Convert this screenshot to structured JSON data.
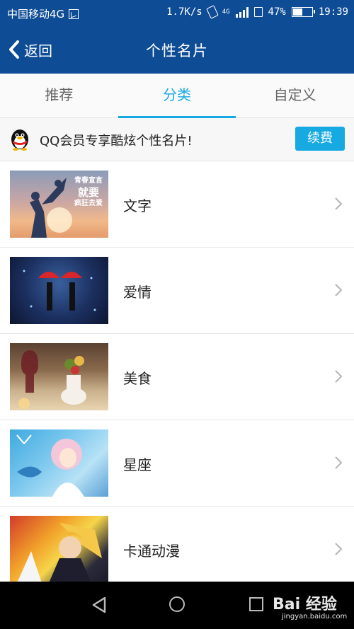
{
  "status_bar": {
    "carrier": "中国移动4G",
    "speed": "1.7K/s",
    "network_type": "4G",
    "battery_percent_text": "47%",
    "battery_level": 0.47,
    "time": "19:39"
  },
  "nav": {
    "back_label": "返回",
    "title": "个性名片"
  },
  "tabs": [
    {
      "label": "推荐",
      "active": false
    },
    {
      "label": "分类",
      "active": true
    },
    {
      "label": "自定义",
      "active": false
    }
  ],
  "promo": {
    "text": "QQ会员专享酷炫个性名片!",
    "button_label": "续费"
  },
  "categories": [
    {
      "label": "文字",
      "thumb_text_1": "青春宣言",
      "thumb_text_2": "就要",
      "thumb_text_3": "疯狂去爱"
    },
    {
      "label": "爱情"
    },
    {
      "label": "美食"
    },
    {
      "label": "星座"
    },
    {
      "label": "卡通动漫"
    }
  ],
  "watermark": {
    "brand": "Bai 经验",
    "url": "jingyan.baidu.com"
  },
  "colors": {
    "header_blue": "#0e4c95",
    "accent": "#17a9e1"
  },
  "icons": [
    "sim-icon",
    "vibrate-icon",
    "signal-icon",
    "lock-icon",
    "battery-icon",
    "back-chevron-icon",
    "qq-penguin-icon",
    "chevron-right-icon",
    "nav-back-icon",
    "nav-home-icon",
    "nav-recent-icon"
  ]
}
